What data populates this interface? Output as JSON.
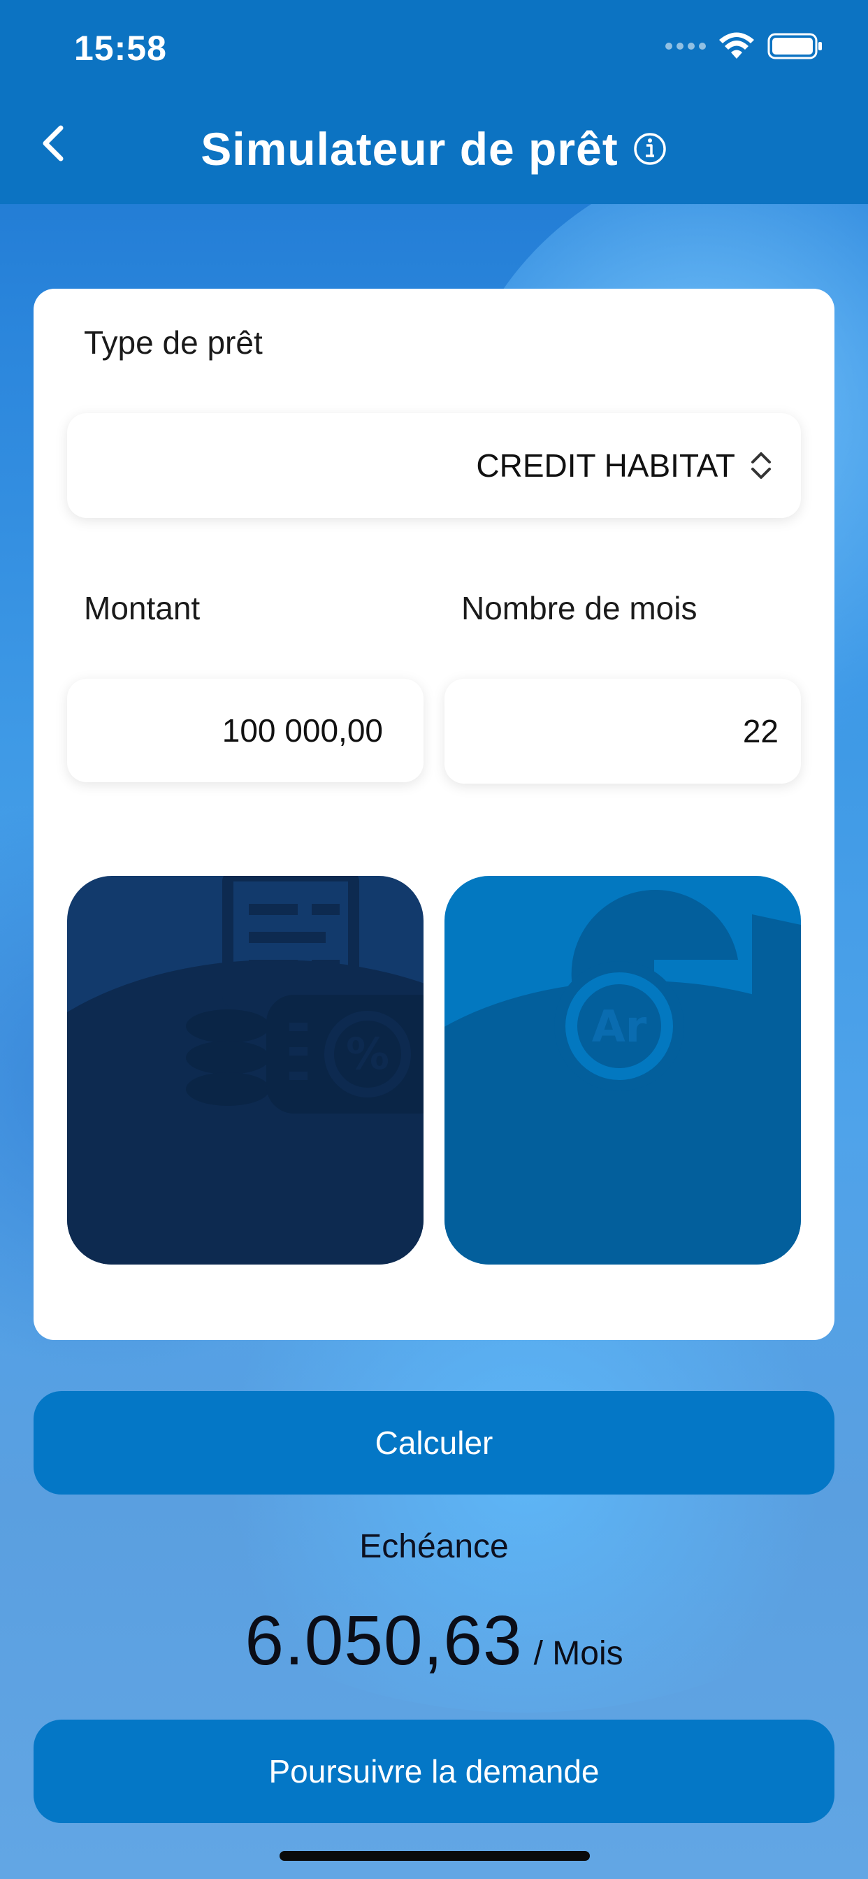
{
  "status_bar": {
    "time": "15:58"
  },
  "nav": {
    "title": "Simulateur de prêt"
  },
  "form": {
    "loan_type_label": "Type de prêt",
    "loan_type_value": "CREDIT HABITAT",
    "amount_label": "Montant",
    "amount_value": "100 000,00",
    "months_label": "Nombre de mois",
    "months_value": "22"
  },
  "tiles": {
    "left_icon": "coins-percent-document-icon",
    "right_icon": "ariary-coin-chart-icon",
    "right_icon_text": "Ar"
  },
  "actions": {
    "calculate_label": "Calculer",
    "continue_label": "Poursuivre la demande"
  },
  "result": {
    "label": "Echéance",
    "value": "6.050,63",
    "unit": "/ Mois"
  },
  "colors": {
    "primary": "#0477c6",
    "header": "#0c73c2",
    "tile_left": "#0d2b52",
    "tile_right": "#0070b8"
  }
}
